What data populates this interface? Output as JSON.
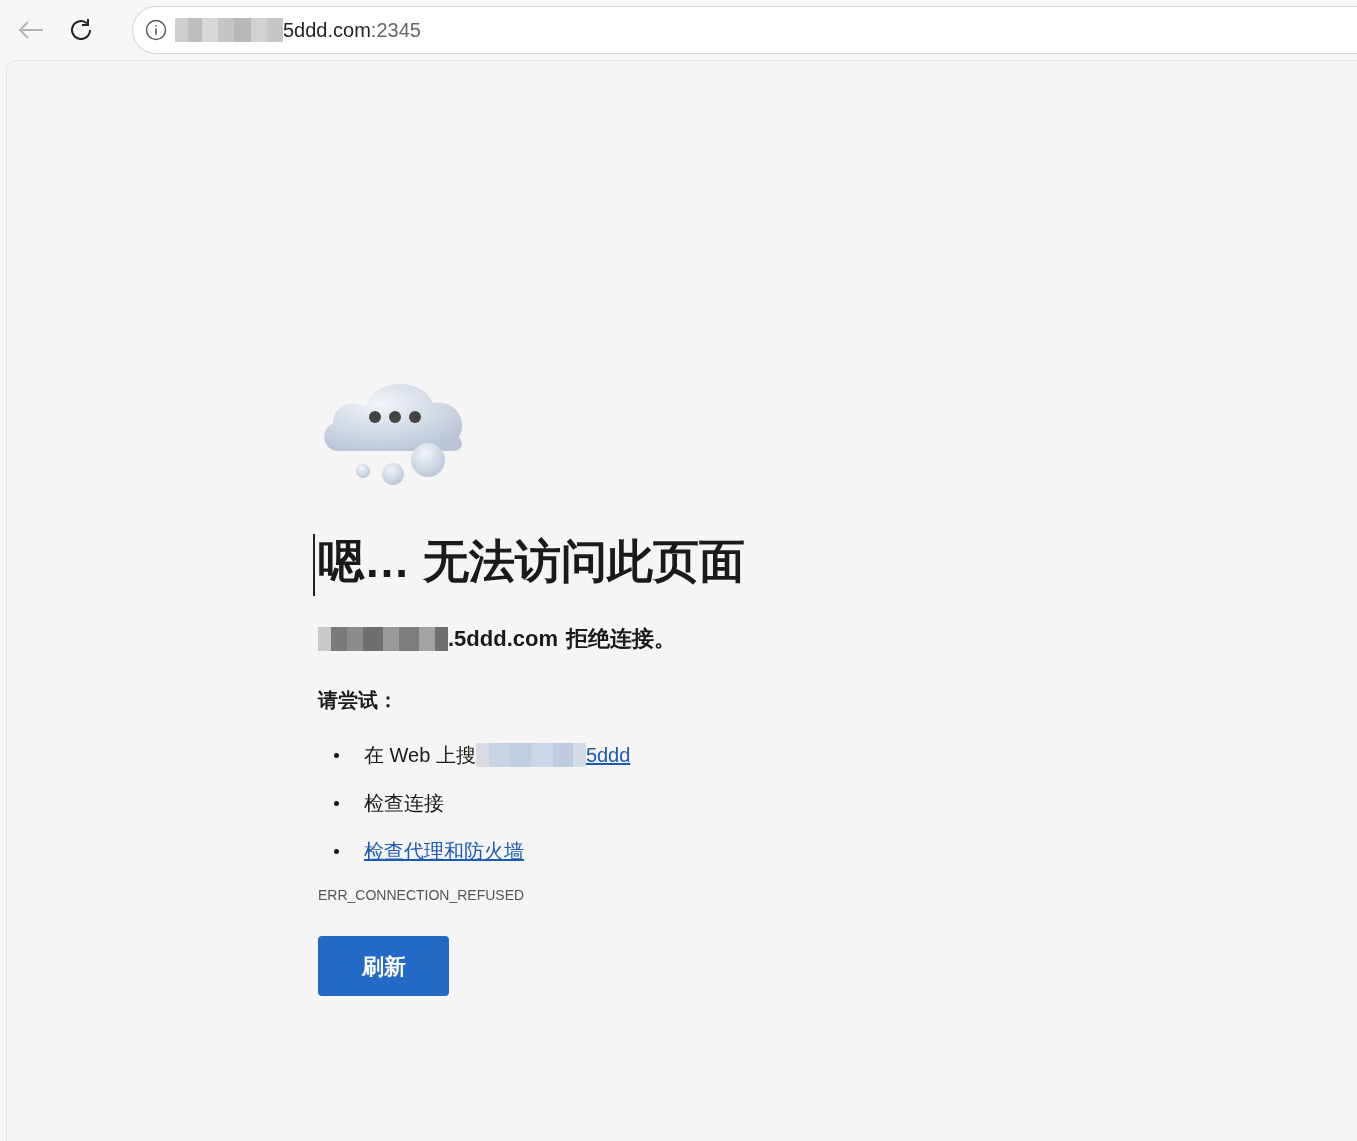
{
  "address_bar": {
    "host": "5ddd.com",
    "port": ":2345"
  },
  "error": {
    "title": "嗯… 无法访问此页面",
    "message_host": ".5ddd.com",
    "message_text": "拒绝连接。",
    "suggestion_heading": "请尝试：",
    "suggestions": [
      {
        "kind": "search",
        "text": "在 Web 上搜",
        "link": "5ddd"
      },
      {
        "kind": "plain",
        "text": "检查连接"
      },
      {
        "kind": "link",
        "link": "检查代理和防火墙"
      }
    ],
    "code": "ERR_CONNECTION_REFUSED",
    "button": "刷新"
  }
}
